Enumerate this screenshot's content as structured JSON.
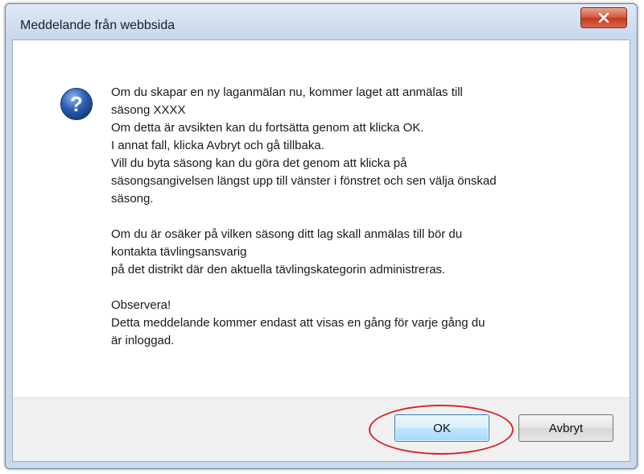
{
  "window": {
    "title": "Meddelande från webbsida",
    "close_icon": "close-icon"
  },
  "message": {
    "icon": "question-icon",
    "paragraphs": [
      [
        "Om du skapar en ny laganmälan nu, kommer laget att anmälas till",
        "säsong XXXX",
        "Om detta är avsikten kan du fortsätta genom att klicka OK.",
        "I annat fall, klicka Avbryt och gå tillbaka.",
        "Vill du byta säsong kan du göra det genom att klicka på",
        "säsongsangivelsen längst upp till vänster i fönstret och sen välja önskad",
        "säsong."
      ],
      [
        "Om du är osäker på vilken säsong ditt lag skall anmälas till bör du",
        "kontakta tävlingsansvarig",
        "på det distrikt där den aktuella tävlingskategorin administreras."
      ],
      [
        "Observera!",
        "Detta meddelande kommer endast att visas en gång för varje gång du",
        "är inloggad."
      ]
    ]
  },
  "buttons": {
    "ok_label": "OK",
    "cancel_label": "Avbryt"
  },
  "colors": {
    "highlight": "#d6262b",
    "close_button": "#c23a1c",
    "question_icon": "#2a5fb4"
  }
}
